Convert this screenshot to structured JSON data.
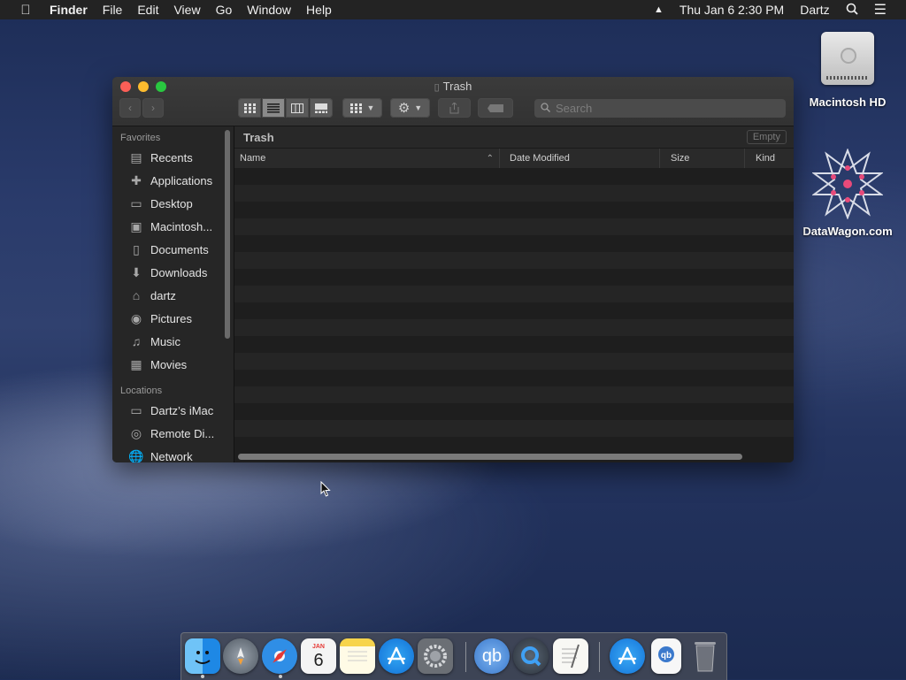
{
  "menubar": {
    "apple_icon": "apple-logo-icon",
    "app_name": "Finder",
    "menus": [
      "File",
      "Edit",
      "View",
      "Go",
      "Window",
      "Help"
    ],
    "datetime": "Thu Jan 6  2:30 PM",
    "user": "Dartz"
  },
  "desktop": {
    "icons": [
      {
        "label": "Macintosh HD",
        "icon": "hard-drive-icon"
      },
      {
        "label": "DataWagon.com",
        "icon": "star-logo-icon"
      }
    ]
  },
  "window": {
    "title": "Trash",
    "search_placeholder": "Search",
    "path_title": "Trash",
    "empty_button": "Empty",
    "sidebar": {
      "favorites_header": "Favorites",
      "favorites": [
        {
          "label": "Recents",
          "icon": "recents-icon"
        },
        {
          "label": "Applications",
          "icon": "applications-icon"
        },
        {
          "label": "Desktop",
          "icon": "desktop-icon"
        },
        {
          "label": "Macintosh...",
          "icon": "disk-icon"
        },
        {
          "label": "Documents",
          "icon": "documents-icon"
        },
        {
          "label": "Downloads",
          "icon": "downloads-icon"
        },
        {
          "label": "dartz",
          "icon": "home-icon"
        },
        {
          "label": "Pictures",
          "icon": "pictures-icon"
        },
        {
          "label": "Music",
          "icon": "music-icon"
        },
        {
          "label": "Movies",
          "icon": "movies-icon"
        }
      ],
      "locations_header": "Locations",
      "locations": [
        {
          "label": "Dartz’s iMac",
          "icon": "imac-icon"
        },
        {
          "label": "Remote Di...",
          "icon": "remote-disc-icon"
        },
        {
          "label": "Network",
          "icon": "network-icon"
        }
      ]
    },
    "columns": {
      "name": "Name",
      "date": "Date Modified",
      "size": "Size",
      "kind": "Kind"
    },
    "active_view": "list"
  },
  "dock": {
    "calendar_day": "6",
    "calendar_month": "JAN",
    "apps": [
      "finder-icon",
      "launchpad-icon",
      "safari-icon",
      "calendar-icon",
      "notes-icon",
      "app-store-icon",
      "system-preferences-icon",
      "qbittorrent-icon",
      "quicktime-icon",
      "textedit-icon",
      "app-store-download-icon",
      "torrent-file-icon",
      "trash-icon"
    ]
  }
}
